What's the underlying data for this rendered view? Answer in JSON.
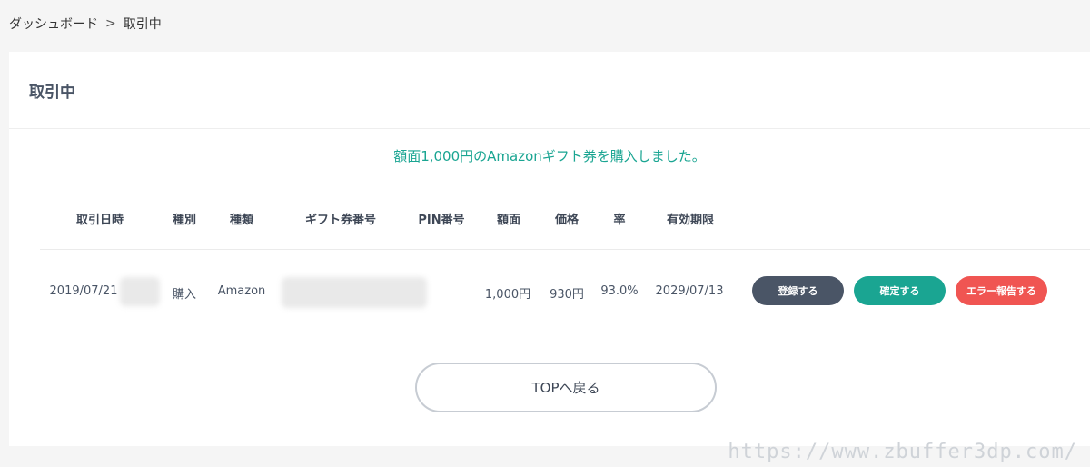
{
  "breadcrumb": {
    "home": "ダッシュボード",
    "separator": ">",
    "current": "取引中"
  },
  "card": {
    "title": "取引中"
  },
  "message": "額面1,000円のAmazonギフト券を購入しました。",
  "table": {
    "headers": [
      "取引日時",
      "種別",
      "種類",
      "ギフト券番号",
      "PIN番号",
      "額面",
      "価格",
      "率",
      "有効期限"
    ],
    "row": {
      "date": "2019/07/21",
      "type": "購入",
      "kind": "Amazon",
      "face_value": "1,000円",
      "price": "930円",
      "rate": "93.0%",
      "expiry": "2029/07/13"
    }
  },
  "actions": {
    "register": "登録する",
    "confirm": "確定する",
    "report_error": "エラー報告する"
  },
  "top_button": "TOPへ戻る",
  "watermark": "https://www.zbuffer3dp.com/",
  "colors": {
    "accent": "#1aa592",
    "dark": "#4a5566",
    "danger": "#f05552"
  }
}
